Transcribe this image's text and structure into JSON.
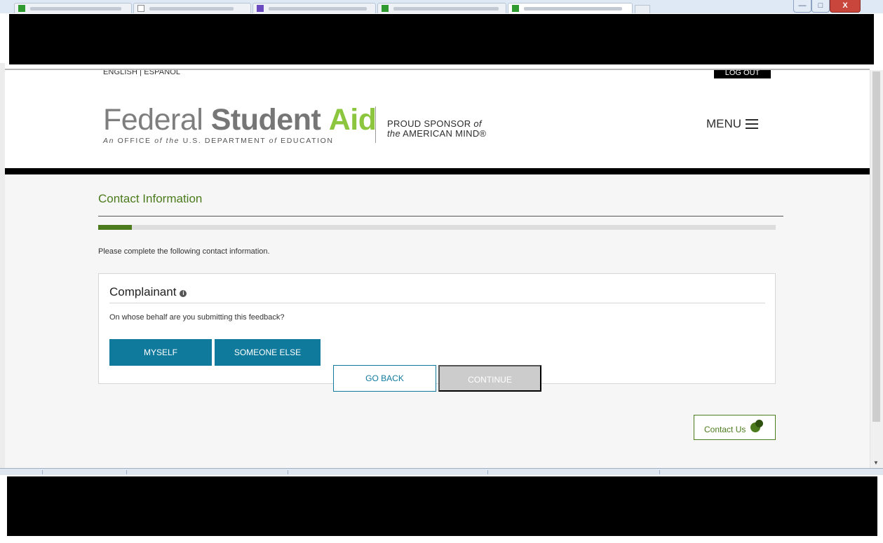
{
  "browser": {
    "tabs": [
      {
        "active": false
      },
      {
        "active": false
      },
      {
        "active": false
      },
      {
        "active": false
      },
      {
        "active": true
      }
    ],
    "window_controls": {
      "minimize_glyph": "—",
      "maximize_glyph": "□",
      "close_glyph": "X"
    }
  },
  "utility_bar": {
    "language": "ENGLISH | ESPANOL",
    "logout": "LOG OUT"
  },
  "header": {
    "logo": {
      "word1": "Federal",
      "word2": "Student",
      "word3": "Aid",
      "tagline_a": "An ",
      "tagline_b": "OFFICE ",
      "tagline_c": "of ",
      "tagline_d": "the ",
      "tagline_e": "U.S. DEPARTMENT ",
      "tagline_f": "of ",
      "tagline_g": "EDUCATION"
    },
    "sponsor_line1": "PROUD SPONSOR ",
    "sponsor_line1_em": "of",
    "sponsor_line2_em": "the",
    "sponsor_line2": " AMERICAN MIND®",
    "menu_label": "MENU"
  },
  "main": {
    "page_title": "Contact Information",
    "progress_percent": 5,
    "intro_text": "Please complete the following contact information.",
    "card": {
      "title": "Complainant",
      "info_glyph": "i",
      "question": "On whose behalf are you submitting this feedback?",
      "options": [
        "MYSELF",
        "SOMEONE ELSE"
      ]
    },
    "buttons": {
      "back": "GO BACK",
      "continue": "CONTINUE"
    },
    "contact_us": "Contact Us"
  },
  "colors": {
    "brand_green": "#4b7b1d",
    "logo_green": "#8cc63e",
    "action_blue": "#107a9d",
    "disabled_gray": "#cccccc"
  },
  "icons": [
    "info-icon",
    "hamburger-menu-icon",
    "chat-bubble-icon",
    "scroll-down-arrow-icon"
  ]
}
